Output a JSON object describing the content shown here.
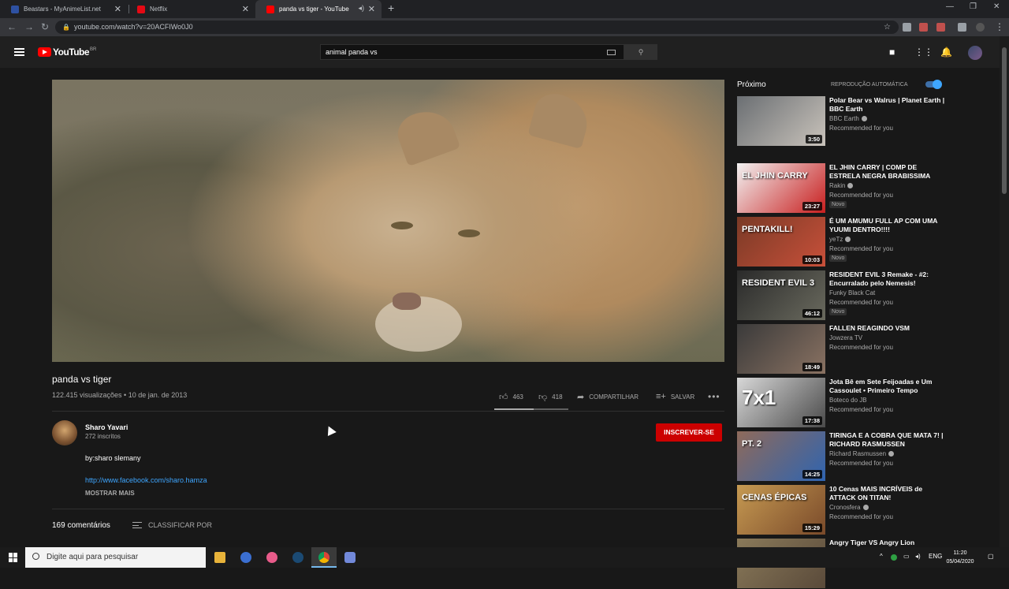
{
  "browser": {
    "tabs": [
      {
        "title": "Beastars - MyAnimeList.net",
        "icon": "myanimelist-icon",
        "color": "#2e51a2"
      },
      {
        "title": "Netflix",
        "icon": "netflix-icon",
        "color": "#e50914"
      },
      {
        "title": "panda vs tiger - YouTube",
        "icon": "youtube-icon",
        "color": "#ff0000"
      }
    ],
    "url": "youtube.com/watch?v=20ACFIWo0J0"
  },
  "youtube": {
    "logo_text": "YouTube",
    "logo_country": "BR",
    "search_value": "animal panda vs"
  },
  "video": {
    "title": "panda vs tiger",
    "views_date": "122.415 visualizações • 10 de jan. de 2013",
    "likes": "463",
    "dislikes": "418",
    "like_fraction": 0.53,
    "share_label": "COMPARTILHAR",
    "save_label": "SALVAR"
  },
  "channel": {
    "name": "Sharo Yavari",
    "subscribers": "272 inscritos",
    "subscribe_label": "INSCREVER-SE"
  },
  "description": {
    "line1": "by:sharo slemany",
    "link": "http://www.facebook.com/sharo.hamza",
    "show_more": "MOSTRAR MAIS"
  },
  "comments": {
    "count": "169 comentários",
    "sort_label": "CLASSIFICAR POR"
  },
  "sidebar": {
    "next_label": "Próximo",
    "autoplay_label": "REPRODUÇÃO AUTOMÁTICA",
    "autoplay_on": true,
    "recommendations": [
      {
        "title": "Polar Bear vs Walrus | Planet Earth | BBC Earth",
        "channel": "BBC Earth",
        "verified": true,
        "meta": "Recommended for you",
        "duration": "3:50",
        "new": "",
        "thumb_colors": [
          "#6b6f73",
          "#c9c3bb"
        ]
      },
      {
        "title": "EL JHIN CARRY | COMP DE ESTRELA NEGRA BRABISSIMA",
        "channel": "Rakin",
        "verified": true,
        "meta": "Recommended for you",
        "duration": "23:27",
        "new": "Novo",
        "thumb_text": "EL JHIN CARRY",
        "thumb_colors": [
          "#f2f2f2",
          "#c81e1e"
        ]
      },
      {
        "title": "É UM AMUMU FULL AP COM UMA YUUMI DENTRO!!!!",
        "channel": "yeTz",
        "verified": true,
        "meta": "Recommended for you",
        "duration": "10:03",
        "new": "Novo",
        "thumb_text": "PENTAKILL!",
        "thumb_colors": [
          "#7a3a26",
          "#c8503a"
        ]
      },
      {
        "title": "RESIDENT EVIL 3 Remake - #2: Encurralado pelo Nemesis!",
        "channel": "Funky Black Cat",
        "verified": false,
        "meta": "Recommended for you",
        "duration": "46:12",
        "new": "Novo",
        "thumb_text": "RESIDENT EVIL 3",
        "thumb_colors": [
          "#2a2a2a",
          "#6a6a5e"
        ]
      },
      {
        "title": "FALLEN REAGINDO VSM",
        "channel": "Jowzera TV",
        "verified": false,
        "meta": "Recommended for you",
        "duration": "18:49",
        "new": "",
        "thumb_colors": [
          "#3a3a3a",
          "#8a7262"
        ]
      },
      {
        "title": "Jota Bê em Sete Feijoadas e Um Cassoulet • Primeiro Tempo",
        "channel": "Boteco do JB",
        "verified": false,
        "meta": "Recommended for you",
        "duration": "17:38",
        "new": "",
        "thumb_text": "7x1",
        "thumb_colors": [
          "#d8d8d8",
          "#4a4a4a"
        ]
      },
      {
        "title": "TIRINGA E A COBRA QUE MATA 7! | RICHARD RASMUSSEN",
        "channel": "Richard Rasmussen",
        "verified": true,
        "meta": "Recommended for you",
        "duration": "14:25",
        "new": "",
        "thumb_text": "PT. 2",
        "thumb_colors": [
          "#8f6a5a",
          "#2f64b0"
        ]
      },
      {
        "title": "10 Cenas MAIS INCRÍVEIS de ATTACK ON TITAN!",
        "channel": "Cronosfera",
        "verified": true,
        "meta": "Recommended for you",
        "duration": "15:29",
        "new": "",
        "thumb_text": "CENAS ÉPICAS",
        "thumb_colors": [
          "#c69a52",
          "#7a4a2a"
        ]
      },
      {
        "title": "Angry Tiger VS Angry Lion",
        "channel": "",
        "verified": false,
        "meta": "",
        "duration": "",
        "new": "",
        "thumb_colors": [
          "#8a7a5a",
          "#5a4a3a"
        ]
      }
    ]
  },
  "taskbar": {
    "search_placeholder": "Digite aqui para pesquisar",
    "language": "ENG",
    "time": "11:20",
    "date": "05/04/2020"
  }
}
